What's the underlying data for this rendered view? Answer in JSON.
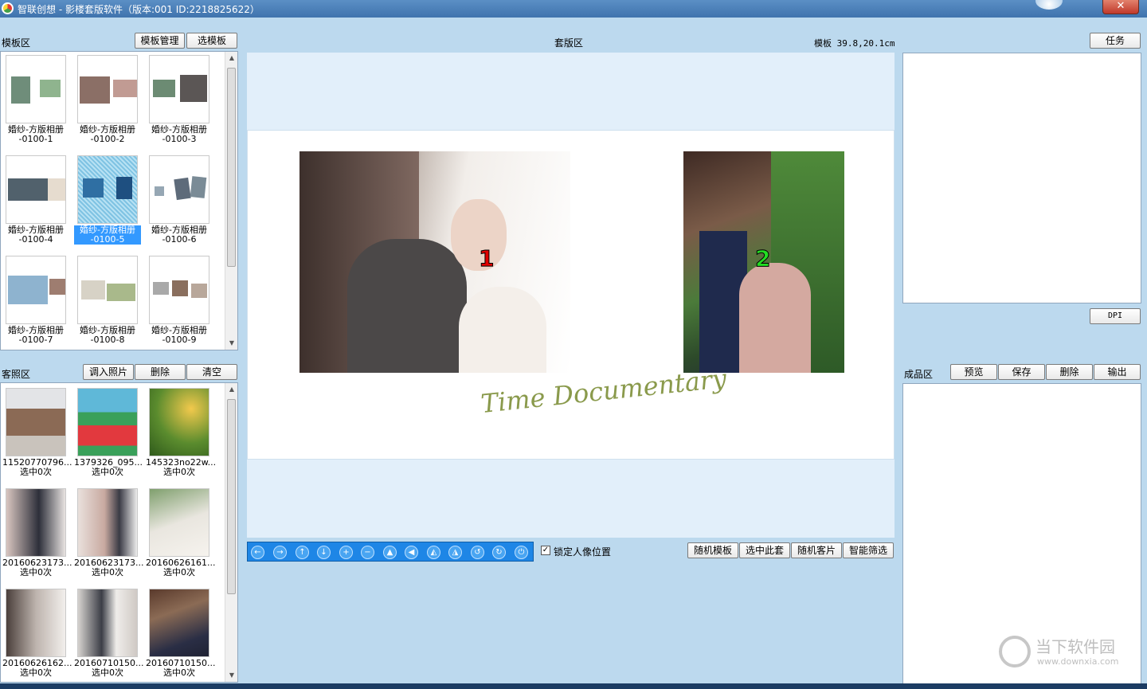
{
  "window": {
    "title": "智联创想 - 影楼套版软件（版本:001   ID:2218825622）",
    "close_glyph": "✕"
  },
  "template_zone": {
    "label": "模板区",
    "manage_button": "模板管理",
    "select_button": "选模板",
    "items": [
      {
        "name": "婚纱-方版相册",
        "code": "-0100-1",
        "selected": false
      },
      {
        "name": "婚纱-方版相册",
        "code": "-0100-2",
        "selected": false
      },
      {
        "name": "婚纱-方版相册",
        "code": "-0100-3",
        "selected": false
      },
      {
        "name": "婚纱-方版相册",
        "code": "-0100-4",
        "selected": false
      },
      {
        "name": "婚纱-方版相册",
        "code": "-0100-5",
        "selected": true
      },
      {
        "name": "婚纱-方版相册",
        "code": "-0100-6",
        "selected": false
      },
      {
        "name": "婚纱-方版相册",
        "code": "-0100-7",
        "selected": false
      },
      {
        "name": "婚纱-方版相册",
        "code": "-0100-8",
        "selected": false
      },
      {
        "name": "婚纱-方版相册",
        "code": "-0100-9",
        "selected": false
      }
    ]
  },
  "client_photo_zone": {
    "label": "客照区",
    "import_button": "调入照片",
    "delete_button": "删除",
    "clear_button": "清空",
    "items": [
      {
        "filename": "11520770796...",
        "status": "选中0次"
      },
      {
        "filename": "1379326_095...",
        "status": "选中0次"
      },
      {
        "filename": "145323no22w...",
        "status": "选中0次"
      },
      {
        "filename": "20160623173...",
        "status": "选中0次"
      },
      {
        "filename": "20160623173...",
        "status": "选中0次"
      },
      {
        "filename": "20160626161...",
        "status": "选中0次"
      },
      {
        "filename": "20160626162...",
        "status": "选中0次"
      },
      {
        "filename": "20160710150...",
        "status": "选中0次"
      },
      {
        "filename": "20160710150...",
        "status": "选中0次"
      }
    ]
  },
  "layout_zone": {
    "label": "套版区",
    "template_size": "模板 39.8,20.1cm",
    "slot1": "1",
    "slot2": "2",
    "script_caption": "Time Documentary",
    "lock_checked": true,
    "lock_label": "锁定人像位置",
    "tools": [
      "left-arrow-icon",
      "right-arrow-icon",
      "up-arrow-icon",
      "down-arrow-icon",
      "zoom-in-icon",
      "zoom-out-icon",
      "flip-up-icon",
      "flip-left-icon",
      "mirror-horizontal-icon",
      "mirror-vertical-icon",
      "rotate-left-icon",
      "rotate-right-icon",
      "power-icon"
    ],
    "random_template_button": "随机模板",
    "select_set_button": "选中此套",
    "random_client_button": "随机客片",
    "smart_filter_button": "智能筛选"
  },
  "task_zone": {
    "task_button": "任务",
    "dpi_button": "DPI"
  },
  "product_zone": {
    "label": "成品区",
    "preview_button": "预览",
    "save_button": "保存",
    "delete_button": "删除",
    "output_button": "输出"
  },
  "watermark": {
    "brand": "当下软件园",
    "url": "www.downxia.com"
  },
  "colors": {
    "background": "#bcd9ee",
    "titlebar": "#4a7fb9",
    "selection": "#3399ff",
    "toolbar": "#1e86e6",
    "slot1": "#e00000",
    "slot2": "#22dd22"
  }
}
